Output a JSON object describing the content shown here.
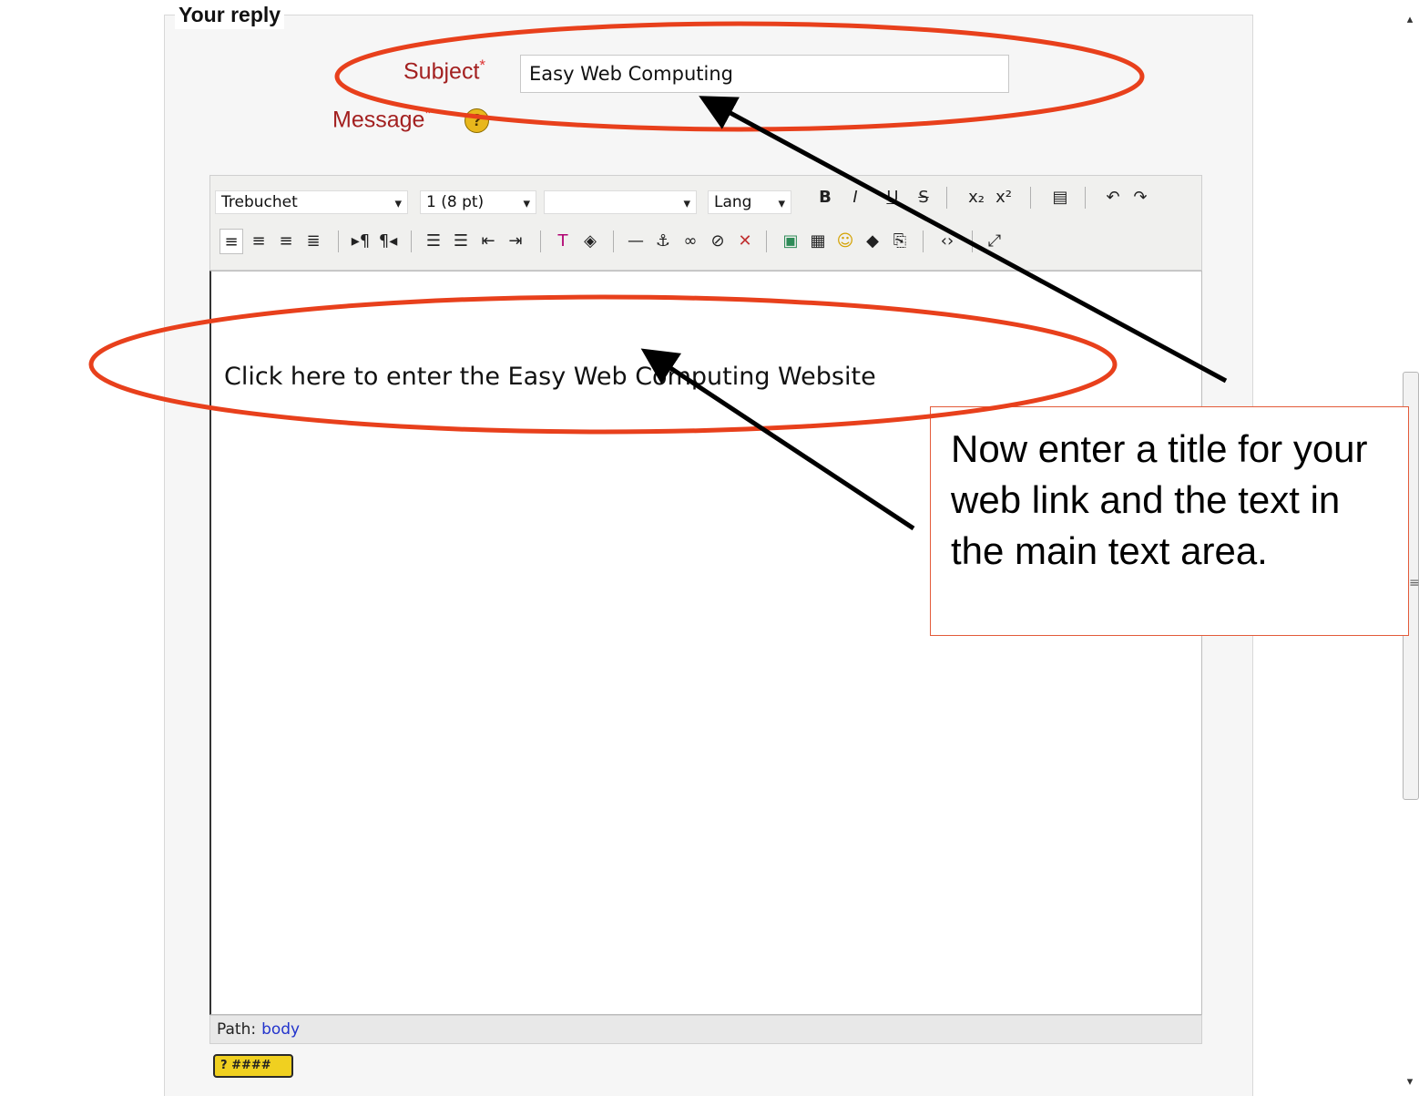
{
  "form": {
    "legend": "Your reply",
    "subject_label": "Subject",
    "message_label": "Message",
    "required_mark": "*",
    "subject_value": "Easy Web Computing",
    "help_glyph": "?"
  },
  "toolbar": {
    "font_family": "Trebuchet",
    "font_size": "1 (8 pt)",
    "style_select": "",
    "lang": "Lang",
    "dropdown_glyph": "▾",
    "row1": [
      {
        "name": "bold-button",
        "glyph": "B"
      },
      {
        "name": "italic-button",
        "glyph": "I"
      },
      {
        "name": "underline-button",
        "glyph": "U"
      },
      {
        "name": "strikethrough-button",
        "glyph": "S"
      },
      {
        "name": "subscript-button",
        "glyph": "x₂"
      },
      {
        "name": "superscript-button",
        "glyph": "x²"
      },
      {
        "name": "paste-word-button",
        "glyph": "▤"
      },
      {
        "name": "undo-button",
        "glyph": "↶"
      },
      {
        "name": "redo-button",
        "glyph": "↷"
      }
    ],
    "row2": [
      {
        "name": "align-left-button",
        "glyph": "≡"
      },
      {
        "name": "align-center-button",
        "glyph": "≡"
      },
      {
        "name": "align-right-button",
        "glyph": "≡"
      },
      {
        "name": "align-justify-button",
        "glyph": "≣"
      },
      {
        "name": "ltr-button",
        "glyph": "▸¶"
      },
      {
        "name": "rtl-button",
        "glyph": "¶◂"
      },
      {
        "name": "ordered-list-button",
        "glyph": "☰"
      },
      {
        "name": "unordered-list-button",
        "glyph": "☰"
      },
      {
        "name": "outdent-button",
        "glyph": "⇤"
      },
      {
        "name": "indent-button",
        "glyph": "⇥"
      },
      {
        "name": "text-color-button",
        "glyph": "T"
      },
      {
        "name": "bg-color-button",
        "glyph": "◈"
      },
      {
        "name": "horizontal-rule-button",
        "glyph": "—"
      },
      {
        "name": "anchor-button",
        "glyph": "⚓"
      },
      {
        "name": "link-button",
        "glyph": "∞"
      },
      {
        "name": "unlink-button",
        "glyph": "⊘"
      },
      {
        "name": "nolink-button",
        "glyph": "✕"
      },
      {
        "name": "image-button",
        "glyph": "▣"
      },
      {
        "name": "table-button",
        "glyph": "▦"
      },
      {
        "name": "smiley-button",
        "glyph": "☺"
      },
      {
        "name": "special-char-button",
        "glyph": "◆"
      },
      {
        "name": "search-replace-button",
        "glyph": "⎘"
      },
      {
        "name": "html-source-button",
        "glyph": "‹›"
      },
      {
        "name": "fullscreen-button",
        "glyph": "⤢"
      }
    ]
  },
  "editor": {
    "content": "Click here to enter the Easy Web Computing Website",
    "path_label": "Path:",
    "path_value": "body"
  },
  "kbd_help": "? ####",
  "callout": {
    "text": "Now enter a title for your web link and the text in the main text area."
  },
  "colors": {
    "annotation_red": "#e8401c",
    "label_red": "#a32020",
    "callout_border": "#e35b3a"
  }
}
